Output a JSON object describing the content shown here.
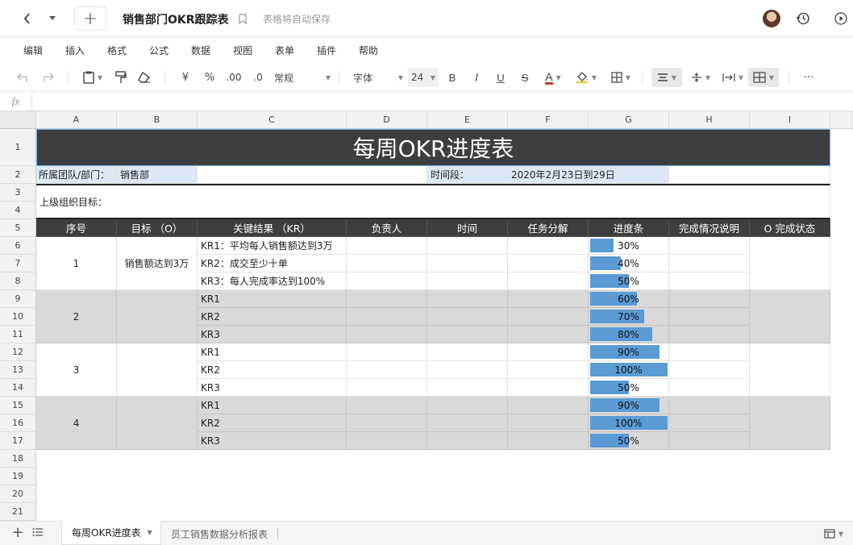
{
  "topbar": {
    "doc_title": "销售部门OKR跟踪表",
    "autosave": "表格将自动保存",
    "back_icon": "chevron-left-icon",
    "add_label": "+"
  },
  "menu": [
    "编辑",
    "插入",
    "格式",
    "公式",
    "数据",
    "视图",
    "表单",
    "插件",
    "帮助"
  ],
  "toolbar": {
    "currency": "¥",
    "percent": "%",
    "decimal_add": ".00",
    "decimal_remove": ".0",
    "number_format": "常规",
    "font_name": "字体",
    "font_size": "24",
    "bold": "B",
    "italic": "I",
    "underline": "U",
    "strike": "S",
    "font_color_letter": "A",
    "more": "···",
    "font_color": "#c0392b"
  },
  "formula_bar": {
    "fx": "fx",
    "value": ""
  },
  "columns": [
    "A",
    "B",
    "C",
    "D",
    "E",
    "F",
    "G",
    "H",
    "I"
  ],
  "rows": [
    "1",
    "2",
    "3",
    "4",
    "5",
    "6",
    "7",
    "8",
    "9",
    "10",
    "11",
    "12",
    "13",
    "14",
    "15",
    "16",
    "17",
    "18",
    "19",
    "20",
    "21"
  ],
  "sheet": {
    "title": "每周OKR进度表",
    "team_label": "所属团队/部门：",
    "team_value": "销售部",
    "period_label": "时间段：",
    "period_value": "2020年2月23日到29日",
    "parent_goal_label": "上级组织目标：",
    "headers": [
      "序号",
      "目标 （O）",
      "关键结果 （KR）",
      "负责人",
      "时间",
      "任务分解",
      "进度条",
      "完成情况说明",
      "O 完成状态"
    ],
    "groups": [
      {
        "seq": "1",
        "objective": "销售额达到3万",
        "krs": [
          "KR1：平均每人销售额达到3万",
          "KR2：成交至少十单",
          "KR3：每人完成率达到100%"
        ],
        "progress": [
          30,
          40,
          50
        ],
        "grey": false
      },
      {
        "seq": "2",
        "objective": "",
        "krs": [
          "KR1",
          "KR2",
          "KR3"
        ],
        "progress": [
          60,
          70,
          80
        ],
        "grey": true
      },
      {
        "seq": "3",
        "objective": "",
        "krs": [
          "KR1",
          "KR2",
          "KR3"
        ],
        "progress": [
          90,
          100,
          50
        ],
        "grey": false
      },
      {
        "seq": "4",
        "objective": "",
        "krs": [
          "KR1",
          "KR2",
          "KR3"
        ],
        "progress": [
          90,
          100,
          50
        ],
        "grey": true
      }
    ],
    "progress_color": "#5b9bd5",
    "header_color": "#3e3e3e"
  },
  "tabs": {
    "active": "每周OKR进度表",
    "other": "员工销售数据分析报表"
  }
}
